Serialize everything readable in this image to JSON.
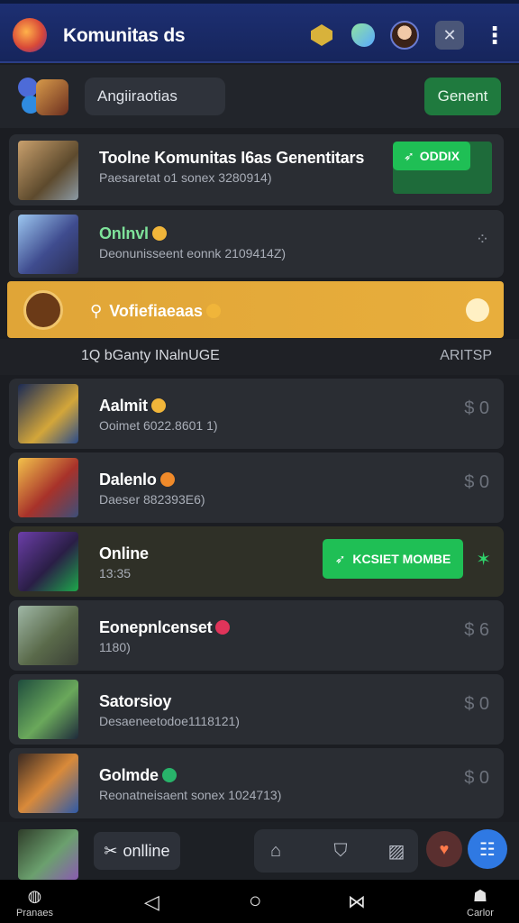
{
  "header": {
    "title": "Komunitas ds"
  },
  "search": {
    "value": "Angiiraotias"
  },
  "toolbar": {
    "general_label": "Genent"
  },
  "items": [
    {
      "title": "Toolne Komunitas I6as Genentitars",
      "subtitle": "Paesaretat o1 sonex 3280914)",
      "action": "ODDIX"
    },
    {
      "title": "Onlnvl",
      "subtitle": "Deonunisseent eonnk 2109414Z)"
    },
    {
      "title": "Aalmit",
      "subtitle": "Ooimet 6022.8601 1)",
      "price": "$ 0"
    },
    {
      "title": "Dalenlo",
      "subtitle": "Daeser 882393E6)",
      "price": "$ 0"
    },
    {
      "title": "Online",
      "subtitle": "13:35",
      "action": "KCSIET MOMBE"
    },
    {
      "title": "Eonepnlcenset",
      "subtitle": "1180)",
      "price": "$ 6"
    },
    {
      "title": "Satorsioy",
      "subtitle": "Desaeneetodoe1118121)",
      "price": "$ 0"
    },
    {
      "title": "Golmde",
      "subtitle": "Reonatneisaent sonex 1024713)",
      "price": "$ 0"
    }
  ],
  "banner": {
    "title": "Vofiefiaeaas"
  },
  "section": {
    "left": "1Q bGanty INalnUGE",
    "right": "ARITSP"
  },
  "bottom": {
    "chip_label": "onlline"
  },
  "sysnav": {
    "left_label": "Pranaes",
    "right_label": "Carlor"
  }
}
